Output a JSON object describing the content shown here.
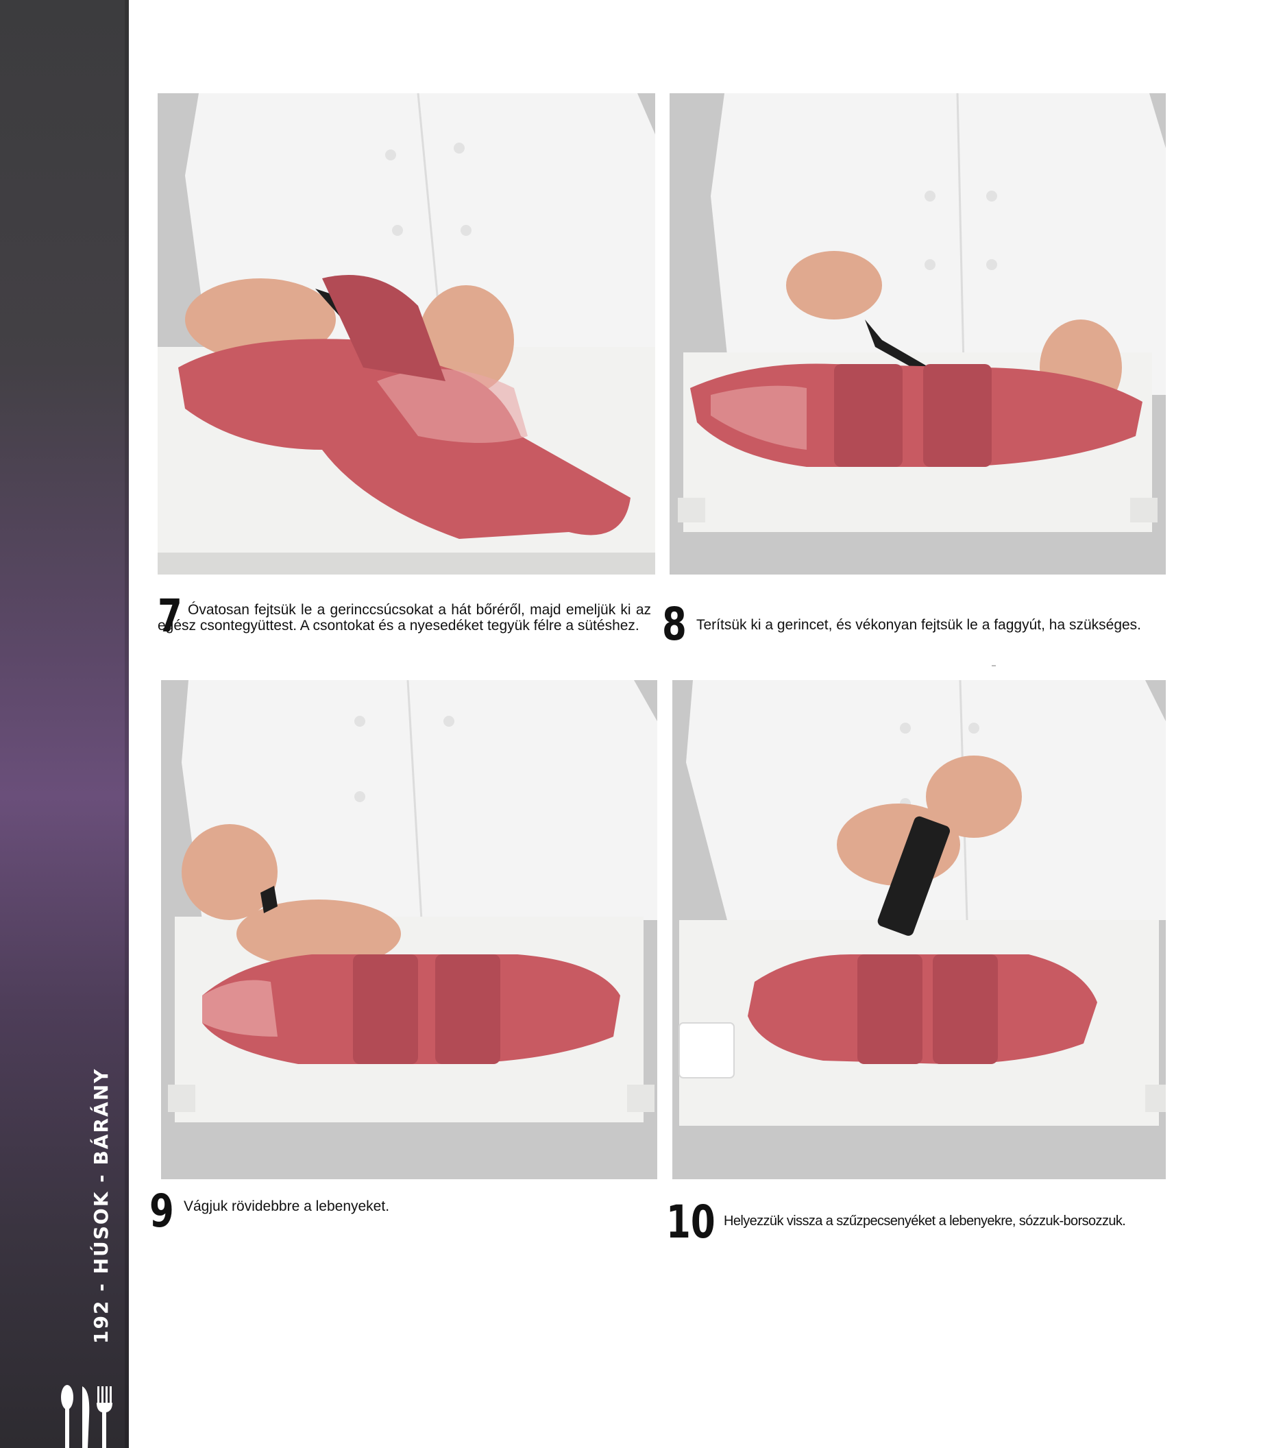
{
  "sidebar": {
    "label": "192 - HÚSOK - BÁRÁNY",
    "band_colors": [
      "#3c3c3e",
      "#6a4f7a",
      "#2d2b30"
    ],
    "icon": "cutlery-icon"
  },
  "steps": [
    {
      "number": "7",
      "text": "Óvatosan fejtsük le a gerinccsúcsokat a hát bőréről, majd emeljük ki az egész csontegyüttest. A csontokat és a nyesedéket tegyük félre a sütéshez."
    },
    {
      "number": "8",
      "text": "Terítsük ki a gerincet, és vékonyan fejtsük le a faggyút, ha szükséges."
    },
    {
      "number": "9",
      "text": "Vágjuk rövidebbre a lebenyeket."
    },
    {
      "number": "10",
      "text": "Helyezzük vissza a szűzpecsenyéket a lebenyekre, sózzuk-borsozzuk."
    }
  ],
  "photo_colors": {
    "background": "#c8c8c8",
    "jacket": "#f4f4f4",
    "board": "#f2f2f0",
    "meat": "#c85a62",
    "meat_light": "#e8a7a6",
    "skin": "#e0a98f",
    "knife": "#1e1e1e"
  }
}
